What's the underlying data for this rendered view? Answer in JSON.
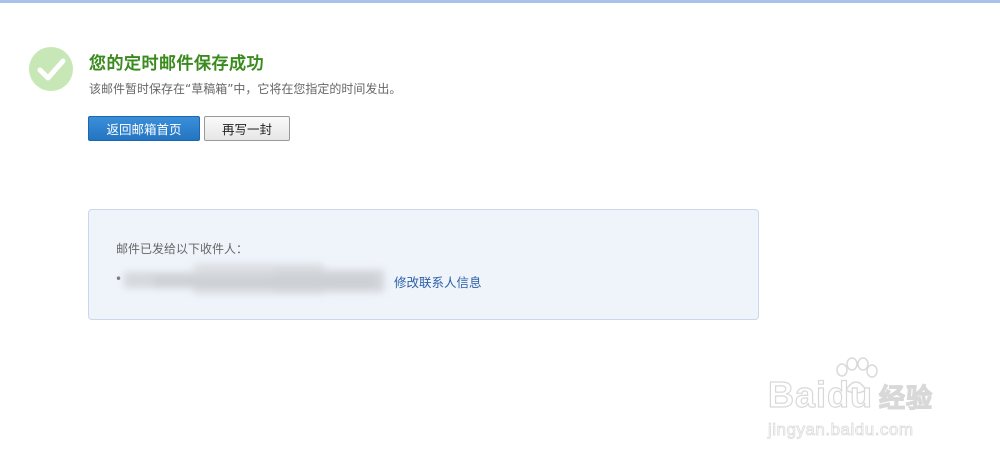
{
  "result": {
    "title": "您的定时邮件保存成功",
    "message": "该邮件暂时保存在“草稿箱”中，它将在您指定的时间发出。",
    "icon": "checkmark-circle-icon",
    "success_color": "#3a8a1e"
  },
  "actions": {
    "back_to_inbox_label": "返回邮箱首页",
    "write_another_label": "再写一封"
  },
  "recipients": {
    "label": "邮件已发给以下收件人：",
    "bullet": "•",
    "items": [
      {
        "address": ""
      }
    ],
    "edit_contact_label": "修改联系人信息"
  },
  "watermark": {
    "brand": "Bai du 经验",
    "brand_latin": "Baidu",
    "brand_cn": "经验",
    "url": "jingyan.baidu.com"
  }
}
